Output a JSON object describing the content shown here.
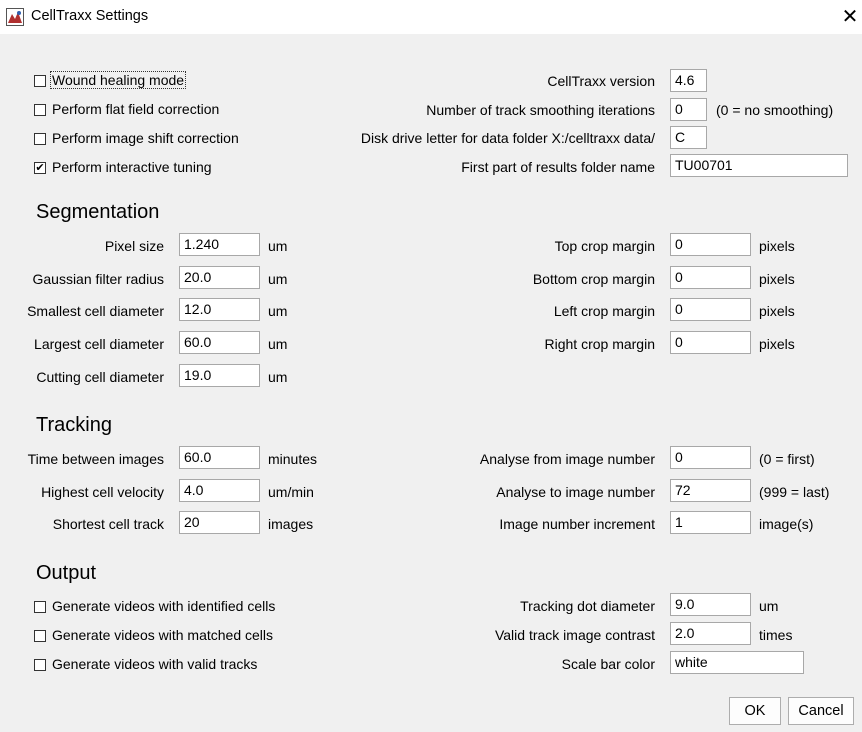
{
  "window": {
    "title": "CellTraxx Settings",
    "close_glyph": "✕"
  },
  "general": {
    "checkboxes": [
      {
        "label": "Wound healing mode",
        "checked": false
      },
      {
        "label": "Perform flat field correction",
        "checked": false
      },
      {
        "label": "Perform image shift correction",
        "checked": false
      },
      {
        "label": "Perform interactive tuning",
        "checked": true
      }
    ],
    "version": {
      "label": "CellTraxx version",
      "value": "4.6"
    },
    "smoothing": {
      "label": "Number of track smoothing iterations",
      "value": "0",
      "note": "(0 = no smoothing)"
    },
    "disk": {
      "label": "Disk drive letter for data folder X:/celltraxx data/",
      "value": "C"
    },
    "results_folder": {
      "label": "First part of results folder name",
      "value": "TU00701"
    }
  },
  "segmentation": {
    "heading": "Segmentation",
    "left": [
      {
        "label": "Pixel size",
        "value": "1.240",
        "unit": "um"
      },
      {
        "label": "Gaussian filter radius",
        "value": "20.0",
        "unit": "um"
      },
      {
        "label": "Smallest cell diameter",
        "value": "12.0",
        "unit": "um"
      },
      {
        "label": "Largest cell diameter",
        "value": "60.0",
        "unit": "um"
      },
      {
        "label": "Cutting cell diameter",
        "value": "19.0",
        "unit": "um"
      }
    ],
    "right": [
      {
        "label": "Top crop margin",
        "value": "0",
        "unit": "pixels"
      },
      {
        "label": "Bottom crop margin",
        "value": "0",
        "unit": "pixels"
      },
      {
        "label": "Left crop margin",
        "value": "0",
        "unit": "pixels"
      },
      {
        "label": "Right crop margin",
        "value": "0",
        "unit": "pixels"
      }
    ]
  },
  "tracking": {
    "heading": "Tracking",
    "left": [
      {
        "label": "Time between images",
        "value": "60.0",
        "unit": "minutes"
      },
      {
        "label": "Highest cell velocity",
        "value": "4.0",
        "unit": "um/min"
      },
      {
        "label": "Shortest cell track",
        "value": "20",
        "unit": "images"
      }
    ],
    "right": [
      {
        "label": "Analyse from image number",
        "value": "0",
        "unit": "(0 = first)"
      },
      {
        "label": "Analyse to image number",
        "value": "72",
        "unit": "(999 = last)"
      },
      {
        "label": "Image number increment",
        "value": "1",
        "unit": "image(s)"
      }
    ]
  },
  "output": {
    "heading": "Output",
    "checkboxes": [
      {
        "label": "Generate videos with identified cells",
        "checked": false
      },
      {
        "label": "Generate videos with matched cells",
        "checked": false
      },
      {
        "label": "Generate videos with valid tracks",
        "checked": false
      }
    ],
    "right": [
      {
        "label": "Tracking  dot diameter",
        "value": "9.0",
        "unit": "um"
      },
      {
        "label": "Valid track image contrast",
        "value": "2.0",
        "unit": "times"
      },
      {
        "label": "Scale bar color",
        "value": "white",
        "unit": ""
      }
    ]
  },
  "buttons": {
    "ok": "OK",
    "cancel": "Cancel"
  }
}
